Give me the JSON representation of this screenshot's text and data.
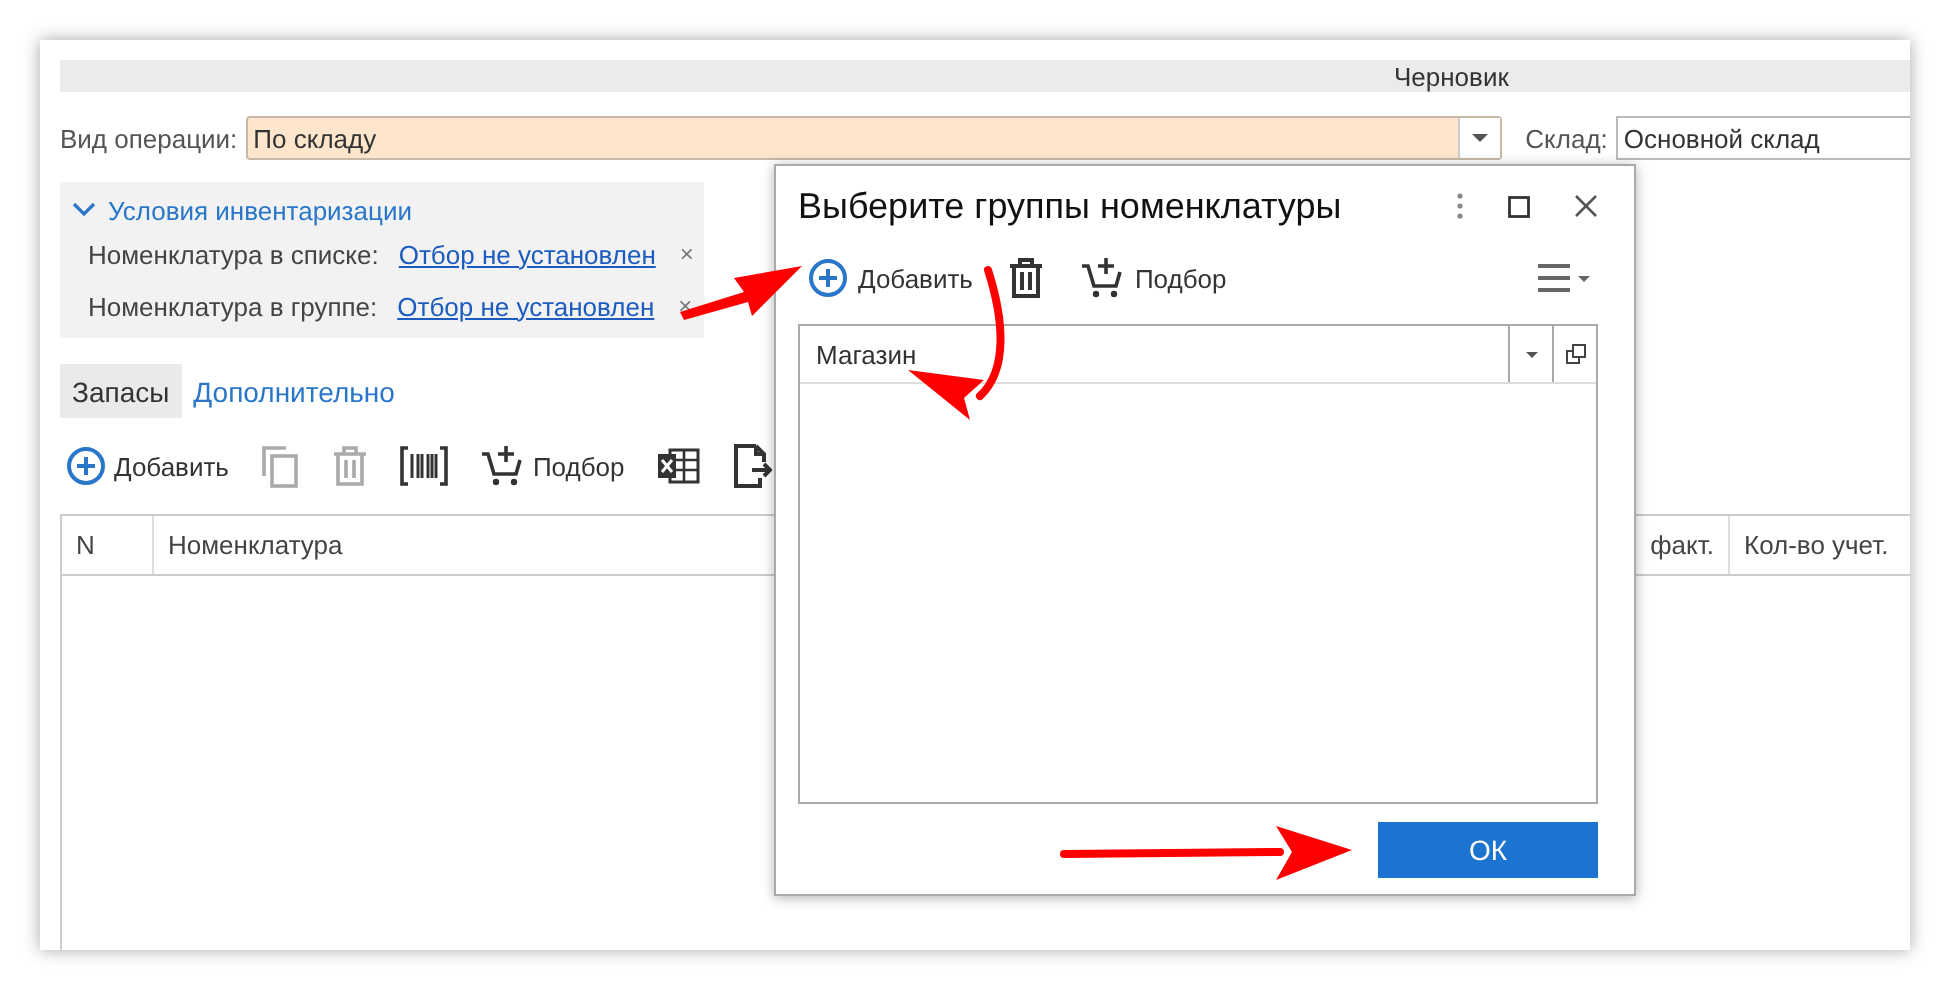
{
  "document": {
    "status": "Черновик",
    "operation_label": "Вид операции:",
    "operation_value": "По складу",
    "warehouse_label": "Склад:",
    "warehouse_value": "Основной склад",
    "conditions": {
      "title": "Условия инвентаризации",
      "expanded": true,
      "rows": [
        {
          "label": "Номенклатура в списке:",
          "link": "Отбор не установлен",
          "clear": "×"
        },
        {
          "label": "Номенклатура в группе:",
          "link": "Отбор не установлен",
          "clear": "×"
        }
      ]
    },
    "tabs": [
      {
        "label": "Запасы",
        "selected": true
      },
      {
        "label": "Дополнительно",
        "selected": false
      }
    ],
    "toolbar": [
      {
        "kind": "add",
        "label": "Добавить",
        "disabled": false
      },
      {
        "kind": "copy",
        "disabled": true
      },
      {
        "kind": "delete",
        "disabled": true
      },
      {
        "kind": "barcode",
        "disabled": false
      },
      {
        "kind": "pick",
        "label": "Подбор",
        "disabled": false
      },
      {
        "kind": "excel",
        "disabled": false
      },
      {
        "kind": "export",
        "disabled": false
      }
    ],
    "table": {
      "columns": [
        {
          "label": "N"
        },
        {
          "label": "Номенклатура"
        },
        {
          "label": "факт."
        },
        {
          "label": "Кол-во учет."
        }
      ]
    }
  },
  "dialog": {
    "title": "Выберите группы номенклатуры",
    "toolbar": [
      {
        "kind": "add",
        "label": "Добавить"
      },
      {
        "kind": "delete"
      },
      {
        "kind": "pick",
        "label": "Подбор"
      }
    ],
    "rows": [
      {
        "value": "Магазин"
      }
    ],
    "ok": "ОК"
  }
}
